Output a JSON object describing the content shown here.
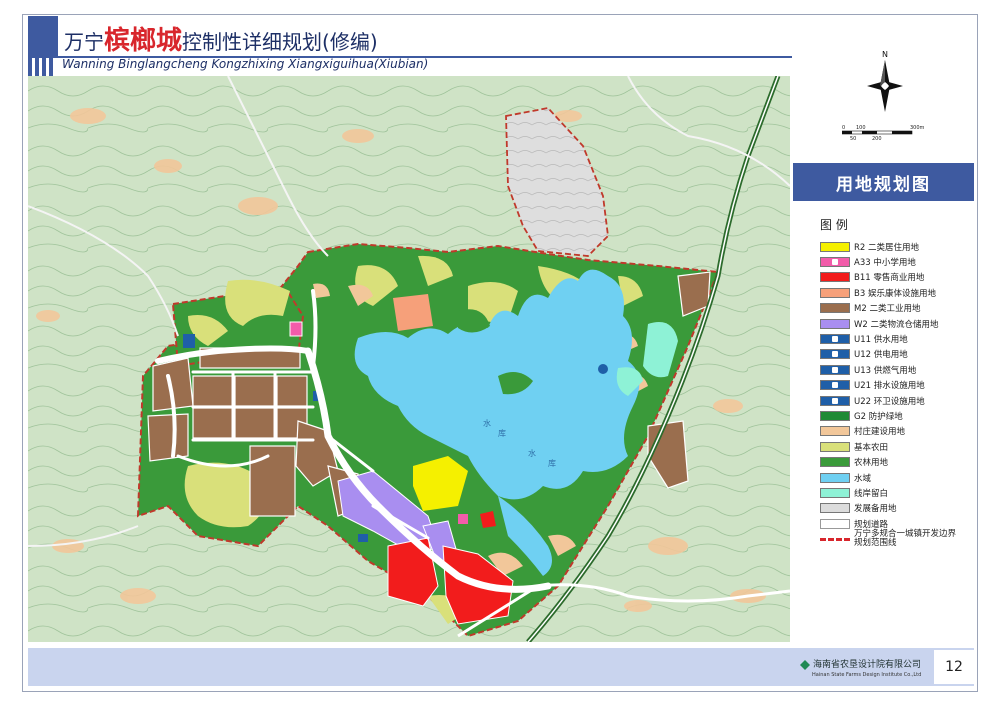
{
  "title": {
    "prefix": "万宁",
    "highlight": "槟榔城",
    "suffix": "控制性详细规划(修编)",
    "english": "Wanning Binglangcheng Kongzhixing Xiangxiguihua(Xiubian)"
  },
  "compass": {
    "north_label": "N"
  },
  "scale_bar": {
    "labels_top": [
      "0",
      "100",
      "300m"
    ],
    "labels_bottom": [
      "50",
      "200"
    ]
  },
  "panel_title": "用地规划图",
  "legend": {
    "title": "图  例",
    "items": [
      {
        "code": "R2",
        "label": "R2 二类居住用地",
        "color": "#f5f000",
        "icon": "none"
      },
      {
        "code": "A33",
        "label": "A33 中小学用地",
        "color": "#f25caa",
        "icon": "school-icon"
      },
      {
        "code": "B11",
        "label": "B11 零售商业用地",
        "color": "#f21c1c",
        "icon": "none"
      },
      {
        "code": "B3",
        "label": "B3 娱乐康体设施用地",
        "color": "#f6a07a",
        "icon": "none"
      },
      {
        "code": "M2",
        "label": "M2 二类工业用地",
        "color": "#9a6e4e",
        "icon": "none"
      },
      {
        "code": "W2",
        "label": "W2 二类物流仓储用地",
        "color": "#a98ef0",
        "icon": "none"
      },
      {
        "code": "U11",
        "label": "U11 供水用地",
        "color": "#1f5fa8",
        "icon": "water-supply-icon"
      },
      {
        "code": "U12",
        "label": "U12 供电用地",
        "color": "#1f5fa8",
        "icon": "power-supply-icon"
      },
      {
        "code": "U13",
        "label": "U13 供燃气用地",
        "color": "#1f5fa8",
        "icon": "gas-supply-icon"
      },
      {
        "code": "U21",
        "label": "U21 排水设施用地",
        "color": "#1f5fa8",
        "icon": "drainage-icon"
      },
      {
        "code": "U22",
        "label": "U22 环卫设施用地",
        "color": "#1f5fa8",
        "icon": "sanitation-icon"
      },
      {
        "code": "G2",
        "label": "G2 防护绿地",
        "color": "#1f8a35",
        "icon": "none"
      },
      {
        "code": "village",
        "label": "村庄建设用地",
        "color": "#f2c79a",
        "icon": "none"
      },
      {
        "code": "farmland",
        "label": "基本农田",
        "color": "#d9e07a",
        "icon": "none"
      },
      {
        "code": "forest",
        "label": "农林用地",
        "color": "#3a9a3a",
        "icon": "none"
      },
      {
        "code": "water",
        "label": "水域",
        "color": "#6fd0f2",
        "icon": "none"
      },
      {
        "code": "wetland",
        "label": "线岸留白",
        "color": "#8ef2d6",
        "icon": "none"
      },
      {
        "code": "reserve",
        "label": "发展备用地",
        "color": "#dcdcdc",
        "icon": "none"
      },
      {
        "code": "road",
        "label": "规划道路",
        "color": "#ffffff",
        "icon": "road-icon"
      },
      {
        "code": "boundary",
        "label": "万宁多规合一城镇开发边界规划范围线",
        "color": "#d8262c",
        "icon": "dashed-line-icon"
      }
    ]
  },
  "map_labels": {
    "lake_1": "水",
    "lake_2": "库",
    "lake_3": "水",
    "lake_4": "库"
  },
  "footer": {
    "company": "海南省农垦设计院有限公司",
    "company_en": "Hainan State Farms Design Institute Co.,Ltd",
    "page_number": "12"
  },
  "colors": {
    "header_blue": "#3e5aa0",
    "title_red": "#d8262c",
    "footer_bg": "#c9d4ee",
    "base_terrain": "#cfe3c6"
  }
}
